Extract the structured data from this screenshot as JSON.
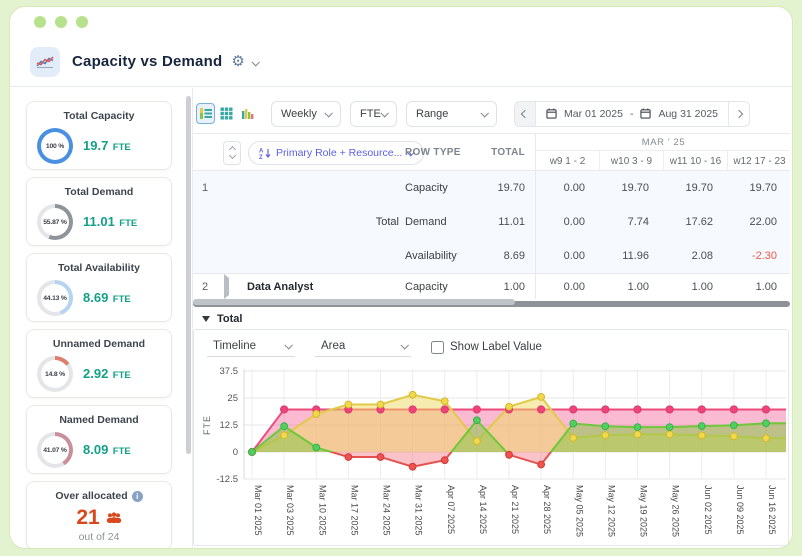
{
  "header": {
    "title": "Capacity vs Demand"
  },
  "sidebar": {
    "cards": [
      {
        "title": "Total Capacity",
        "percent": "100 %",
        "value": "19.7",
        "unit": "FTE",
        "ring_color": "#4a90e2",
        "ring_pct": 100
      },
      {
        "title": "Total Demand",
        "percent": "55.87 %",
        "value": "11.01",
        "unit": "FTE",
        "ring_color": "#8f949b",
        "ring_pct": 55.87
      },
      {
        "title": "Total Availability",
        "percent": "44.13 %",
        "value": "8.69",
        "unit": "FTE",
        "ring_color": "#b5d4f0",
        "ring_pct": 44.13
      },
      {
        "title": "Unnamed Demand",
        "percent": "14.8 %",
        "value": "2.92",
        "unit": "FTE",
        "ring_color": "#dd7e6b",
        "ring_pct": 14.8
      },
      {
        "title": "Named Demand",
        "percent": "41.07 %",
        "value": "8.09",
        "unit": "FTE",
        "ring_color": "#c9909b",
        "ring_pct": 41.07
      }
    ],
    "over_allocated": {
      "title": "Over allocated",
      "count": "21",
      "suffix": "out of 24",
      "accent": "#d9481c"
    }
  },
  "toolbar": {
    "granularity": "Weekly",
    "metric": "FTE",
    "range_label": "Range",
    "date_from": "Mar 01 2025",
    "date_separator": "-",
    "date_to": "Aug 31 2025"
  },
  "table": {
    "group_by": "Primary Role + Resource...",
    "row_type_header": "ROW TYPE",
    "total_header": "TOTAL",
    "month_header": "MAR ' 25",
    "week_headers": [
      "w9 1 - 2",
      "w10 3 - 9",
      "w11 10 - 16",
      "w12 17 - 23"
    ],
    "groups": [
      {
        "num": "1",
        "group_label": "Total",
        "rows": [
          {
            "row_type": "Capacity",
            "total": "19.70",
            "weeks": [
              "0.00",
              "19.70",
              "19.70",
              "19.70"
            ]
          },
          {
            "row_type": "Demand",
            "total": "11.01",
            "weeks": [
              "0.00",
              "7.74",
              "17.62",
              "22.00"
            ]
          },
          {
            "row_type": "Availability",
            "total": "8.69",
            "weeks": [
              "0.00",
              "11.96",
              "2.08",
              "-2.30"
            ]
          }
        ]
      },
      {
        "num": "2",
        "name": "Data Analyst",
        "rows": [
          {
            "row_type": "Capacity",
            "total": "1.00",
            "weeks": [
              "0.00",
              "1.00",
              "1.00",
              "1.00"
            ]
          }
        ]
      }
    ]
  },
  "chart_section": {
    "section_title": "Total",
    "chart_type_label": "Timeline",
    "style_label": "Area",
    "checkbox_label": "Show Label Value"
  },
  "chart_data": {
    "type": "area",
    "title": "Total",
    "ylabel": "FTE",
    "yticks": [
      37.5,
      25,
      12.5,
      0,
      -12.5
    ],
    "ylim": [
      -15,
      40
    ],
    "grid": true,
    "legend": "none",
    "x": [
      "Mar 01 2025",
      "Mar 03 2025",
      "Mar 10 2025",
      "Mar 17 2025",
      "Mar 24 2025",
      "Mar 31 2025",
      "Apr 07 2025",
      "Apr 14 2025",
      "Apr 21 2025",
      "Apr 28 2025",
      "May 05 2025",
      "May 12 2025",
      "May 19 2025",
      "May 26 2025",
      "Jun 02 2025",
      "Jun 09 2025",
      "Jun 16 2025"
    ],
    "series": [
      {
        "name": "Capacity",
        "color": "#ee4b7d",
        "marker_color": "#f1437a",
        "fill": "rgba(243,91,148,0.42)",
        "values": [
          0,
          19.7,
          19.7,
          19.7,
          19.7,
          19.7,
          19.7,
          19.7,
          19.7,
          19.7,
          19.7,
          19.7,
          19.7,
          19.7,
          19.7,
          19.7,
          19.7
        ]
      },
      {
        "name": "Demand",
        "color": "#e0ca47",
        "marker_color": "#f0d94f",
        "fill": "rgba(240,217,95,0.5)",
        "values": [
          0,
          7.74,
          17.62,
          22,
          22,
          26.5,
          23.5,
          5,
          21,
          25.5,
          6.5,
          7.8,
          8.2,
          8.2,
          7.7,
          7.3,
          6.4
        ]
      },
      {
        "name": "Availability",
        "color_positive": "#6fc83b",
        "color_negative": "#e5514e",
        "marker_positive": "#4fd05f",
        "marker_negative": "#ef5350",
        "fill_positive": "rgba(139,199,72,0.55)",
        "fill_negative": "rgba(242,98,112,0.38)",
        "values": [
          0,
          11.96,
          2.08,
          -2.3,
          -2.3,
          -6.8,
          -3.8,
          14.7,
          -1.3,
          -5.8,
          13.2,
          11.9,
          11.5,
          11.5,
          12,
          12.4,
          13.3
        ]
      }
    ]
  }
}
